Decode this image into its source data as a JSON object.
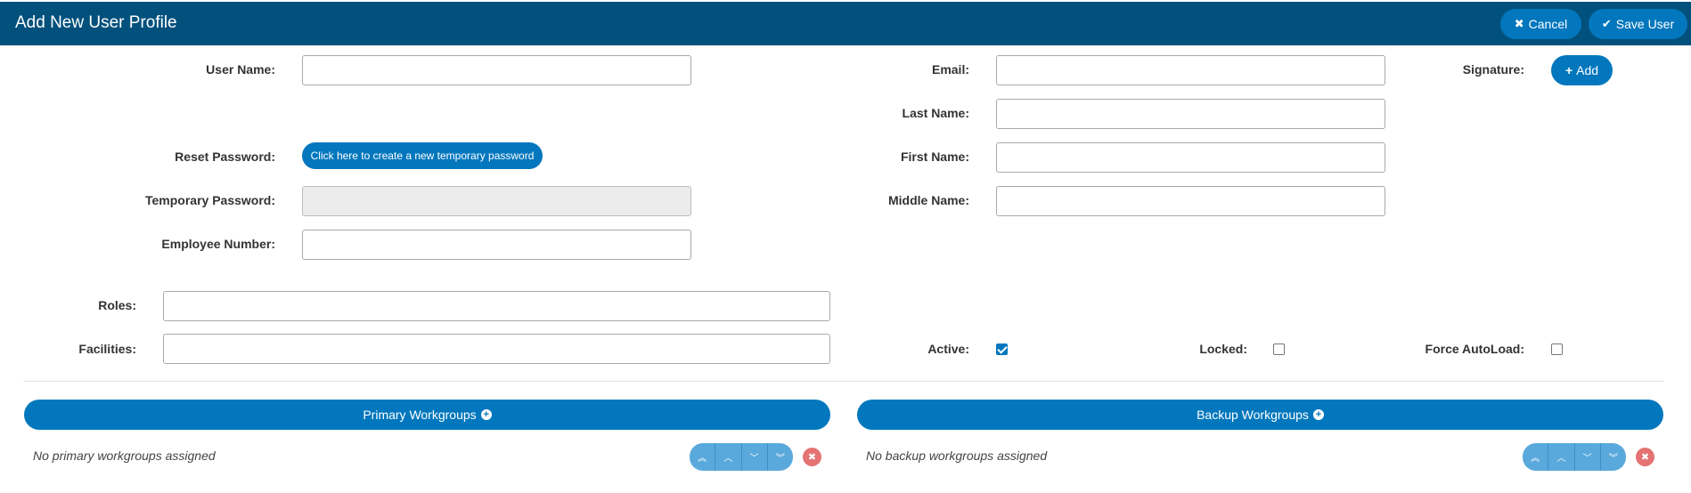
{
  "header": {
    "title": "Add New User Profile",
    "cancel_label": "Cancel",
    "save_label": "Save User"
  },
  "form": {
    "user_name_label": "User Name:",
    "user_name_value": "",
    "reset_password_label": "Reset Password:",
    "reset_password_button": "Click here to create a new temporary password",
    "temp_password_label": "Temporary Password:",
    "temp_password_value": "",
    "employee_number_label": "Employee Number:",
    "employee_number_value": "",
    "email_label": "Email:",
    "email_value": "",
    "last_name_label": "Last Name:",
    "last_name_value": "",
    "first_name_label": "First Name:",
    "first_name_value": "",
    "middle_name_label": "Middle Name:",
    "middle_name_value": "",
    "signature_label": "Signature:",
    "signature_add_label": "Add",
    "roles_label": "Roles:",
    "roles_value": "",
    "facilities_label": "Facilities:",
    "facilities_value": "",
    "active_label": "Active:",
    "active_checked": true,
    "locked_label": "Locked:",
    "locked_checked": false,
    "force_autoload_label": "Force AutoLoad:",
    "force_autoload_checked": false
  },
  "workgroups": {
    "primary_label": "Primary Workgroups",
    "primary_empty": "No primary workgroups assigned",
    "backup_label": "Backup Workgroups",
    "backup_empty": "No backup workgroups assigned"
  },
  "icons": {
    "cancel": "close-icon",
    "save": "check-icon",
    "add": "plus-icon",
    "add_workgroup": "plus-circle-icon",
    "move_top": "double-chevron-up-icon",
    "move_up": "chevron-up-icon",
    "move_down": "chevron-down-icon",
    "move_bottom": "double-chevron-down-icon",
    "remove": "remove-circle-icon"
  },
  "colors": {
    "header_bg": "#02507c",
    "accent": "#0277bd",
    "move_buttons": "#5aa9dc",
    "remove": "#e57373"
  }
}
